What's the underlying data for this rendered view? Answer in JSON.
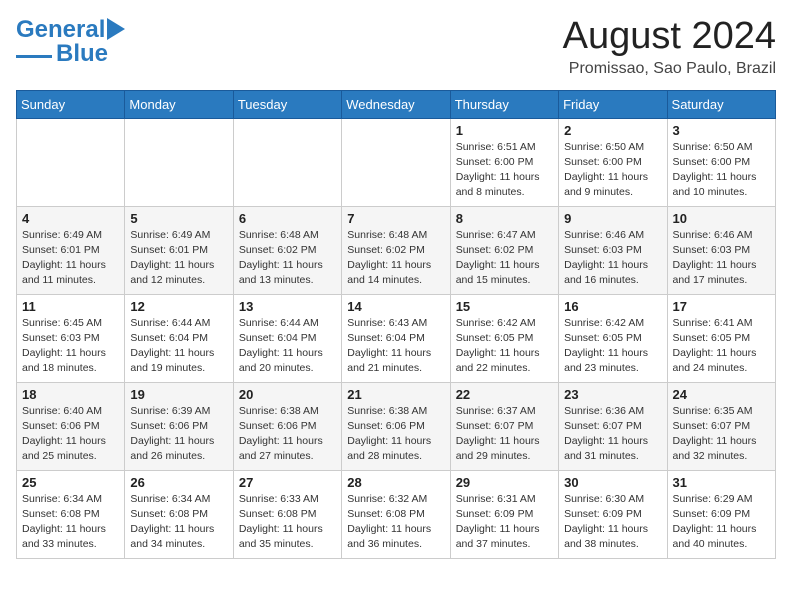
{
  "header": {
    "logo_line1": "General",
    "logo_line2": "Blue",
    "main_title": "August 2024",
    "subtitle": "Promissao, Sao Paulo, Brazil"
  },
  "days_of_week": [
    "Sunday",
    "Monday",
    "Tuesday",
    "Wednesday",
    "Thursday",
    "Friday",
    "Saturday"
  ],
  "weeks": [
    [
      {
        "day": "",
        "info": ""
      },
      {
        "day": "",
        "info": ""
      },
      {
        "day": "",
        "info": ""
      },
      {
        "day": "",
        "info": ""
      },
      {
        "day": "1",
        "info": "Sunrise: 6:51 AM\nSunset: 6:00 PM\nDaylight: 11 hours\nand 8 minutes."
      },
      {
        "day": "2",
        "info": "Sunrise: 6:50 AM\nSunset: 6:00 PM\nDaylight: 11 hours\nand 9 minutes."
      },
      {
        "day": "3",
        "info": "Sunrise: 6:50 AM\nSunset: 6:00 PM\nDaylight: 11 hours\nand 10 minutes."
      }
    ],
    [
      {
        "day": "4",
        "info": "Sunrise: 6:49 AM\nSunset: 6:01 PM\nDaylight: 11 hours\nand 11 minutes."
      },
      {
        "day": "5",
        "info": "Sunrise: 6:49 AM\nSunset: 6:01 PM\nDaylight: 11 hours\nand 12 minutes."
      },
      {
        "day": "6",
        "info": "Sunrise: 6:48 AM\nSunset: 6:02 PM\nDaylight: 11 hours\nand 13 minutes."
      },
      {
        "day": "7",
        "info": "Sunrise: 6:48 AM\nSunset: 6:02 PM\nDaylight: 11 hours\nand 14 minutes."
      },
      {
        "day": "8",
        "info": "Sunrise: 6:47 AM\nSunset: 6:02 PM\nDaylight: 11 hours\nand 15 minutes."
      },
      {
        "day": "9",
        "info": "Sunrise: 6:46 AM\nSunset: 6:03 PM\nDaylight: 11 hours\nand 16 minutes."
      },
      {
        "day": "10",
        "info": "Sunrise: 6:46 AM\nSunset: 6:03 PM\nDaylight: 11 hours\nand 17 minutes."
      }
    ],
    [
      {
        "day": "11",
        "info": "Sunrise: 6:45 AM\nSunset: 6:03 PM\nDaylight: 11 hours\nand 18 minutes."
      },
      {
        "day": "12",
        "info": "Sunrise: 6:44 AM\nSunset: 6:04 PM\nDaylight: 11 hours\nand 19 minutes."
      },
      {
        "day": "13",
        "info": "Sunrise: 6:44 AM\nSunset: 6:04 PM\nDaylight: 11 hours\nand 20 minutes."
      },
      {
        "day": "14",
        "info": "Sunrise: 6:43 AM\nSunset: 6:04 PM\nDaylight: 11 hours\nand 21 minutes."
      },
      {
        "day": "15",
        "info": "Sunrise: 6:42 AM\nSunset: 6:05 PM\nDaylight: 11 hours\nand 22 minutes."
      },
      {
        "day": "16",
        "info": "Sunrise: 6:42 AM\nSunset: 6:05 PM\nDaylight: 11 hours\nand 23 minutes."
      },
      {
        "day": "17",
        "info": "Sunrise: 6:41 AM\nSunset: 6:05 PM\nDaylight: 11 hours\nand 24 minutes."
      }
    ],
    [
      {
        "day": "18",
        "info": "Sunrise: 6:40 AM\nSunset: 6:06 PM\nDaylight: 11 hours\nand 25 minutes."
      },
      {
        "day": "19",
        "info": "Sunrise: 6:39 AM\nSunset: 6:06 PM\nDaylight: 11 hours\nand 26 minutes."
      },
      {
        "day": "20",
        "info": "Sunrise: 6:38 AM\nSunset: 6:06 PM\nDaylight: 11 hours\nand 27 minutes."
      },
      {
        "day": "21",
        "info": "Sunrise: 6:38 AM\nSunset: 6:06 PM\nDaylight: 11 hours\nand 28 minutes."
      },
      {
        "day": "22",
        "info": "Sunrise: 6:37 AM\nSunset: 6:07 PM\nDaylight: 11 hours\nand 29 minutes."
      },
      {
        "day": "23",
        "info": "Sunrise: 6:36 AM\nSunset: 6:07 PM\nDaylight: 11 hours\nand 31 minutes."
      },
      {
        "day": "24",
        "info": "Sunrise: 6:35 AM\nSunset: 6:07 PM\nDaylight: 11 hours\nand 32 minutes."
      }
    ],
    [
      {
        "day": "25",
        "info": "Sunrise: 6:34 AM\nSunset: 6:08 PM\nDaylight: 11 hours\nand 33 minutes."
      },
      {
        "day": "26",
        "info": "Sunrise: 6:34 AM\nSunset: 6:08 PM\nDaylight: 11 hours\nand 34 minutes."
      },
      {
        "day": "27",
        "info": "Sunrise: 6:33 AM\nSunset: 6:08 PM\nDaylight: 11 hours\nand 35 minutes."
      },
      {
        "day": "28",
        "info": "Sunrise: 6:32 AM\nSunset: 6:08 PM\nDaylight: 11 hours\nand 36 minutes."
      },
      {
        "day": "29",
        "info": "Sunrise: 6:31 AM\nSunset: 6:09 PM\nDaylight: 11 hours\nand 37 minutes."
      },
      {
        "day": "30",
        "info": "Sunrise: 6:30 AM\nSunset: 6:09 PM\nDaylight: 11 hours\nand 38 minutes."
      },
      {
        "day": "31",
        "info": "Sunrise: 6:29 AM\nSunset: 6:09 PM\nDaylight: 11 hours\nand 40 minutes."
      }
    ]
  ]
}
